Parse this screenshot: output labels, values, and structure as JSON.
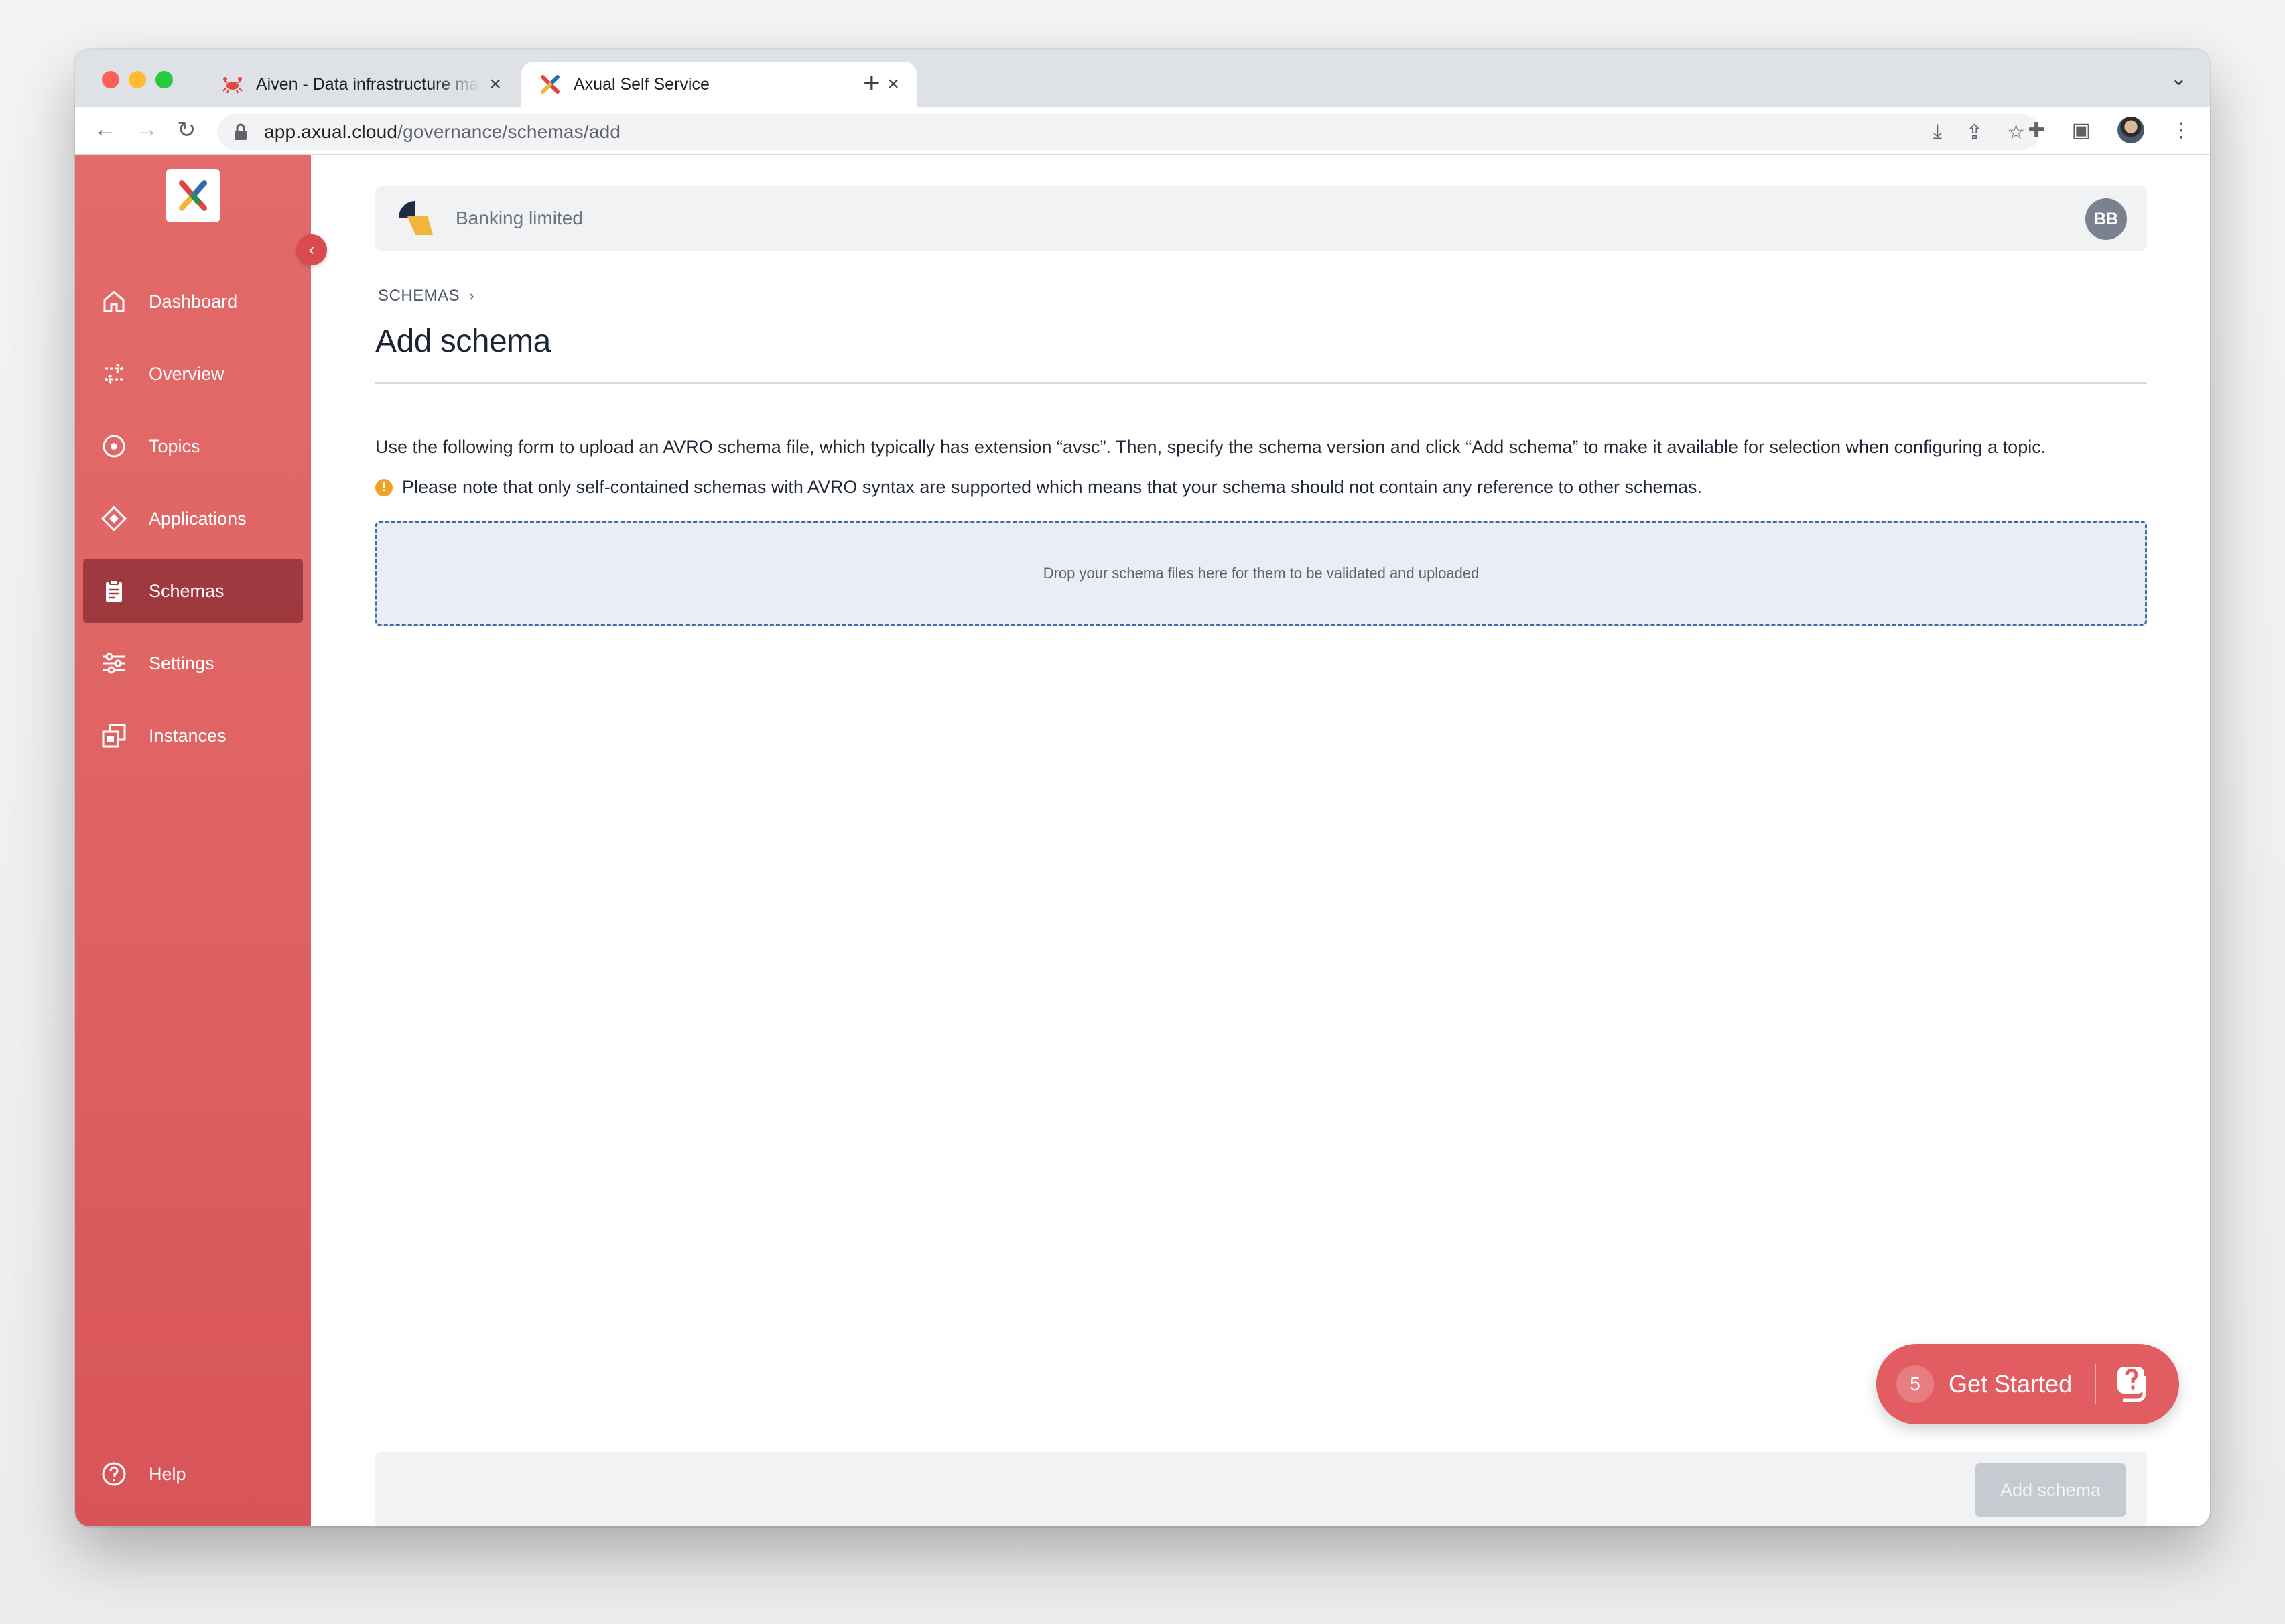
{
  "browser": {
    "tabs": [
      {
        "title": "Aiven - Data infrastructure made simple",
        "active": false
      },
      {
        "title": "Axual Self Service",
        "active": true
      }
    ],
    "url_host": "app.axual.cloud",
    "url_path": "/governance/schemas/add"
  },
  "sidebar": {
    "items": [
      {
        "label": "Dashboard",
        "icon": "home-icon"
      },
      {
        "label": "Overview",
        "icon": "flow-icon"
      },
      {
        "label": "Topics",
        "icon": "topic-icon"
      },
      {
        "label": "Applications",
        "icon": "application-icon"
      },
      {
        "label": "Schemas",
        "icon": "clipboard-icon",
        "active": true
      },
      {
        "label": "Settings",
        "icon": "sliders-icon"
      },
      {
        "label": "Instances",
        "icon": "instances-icon"
      }
    ],
    "help_label": "Help"
  },
  "header": {
    "org_name": "Banking limited",
    "user_initials": "BB"
  },
  "page": {
    "breadcrumb": "SCHEMAS",
    "title": "Add schema",
    "description": "Use the following form to upload an AVRO schema file, which typically has extension “avsc”. Then, specify the schema version and click “Add schema” to make it available for selection when configuring a topic.",
    "note": "Please note that only self-contained schemas with AVRO syntax are supported which means that your schema should not contain any reference to other schemas.",
    "dropzone_text": "Drop your schema files here for them to be validated and uploaded"
  },
  "get_started": {
    "count": "5",
    "label": "Get Started"
  },
  "footer": {
    "add_button": "Add schema"
  },
  "colors": {
    "sidebar": "#e36a6a",
    "sidebar_active": "#9e3a3f",
    "accent": "#e25d61",
    "dropzone_border": "#3b6ea5"
  }
}
